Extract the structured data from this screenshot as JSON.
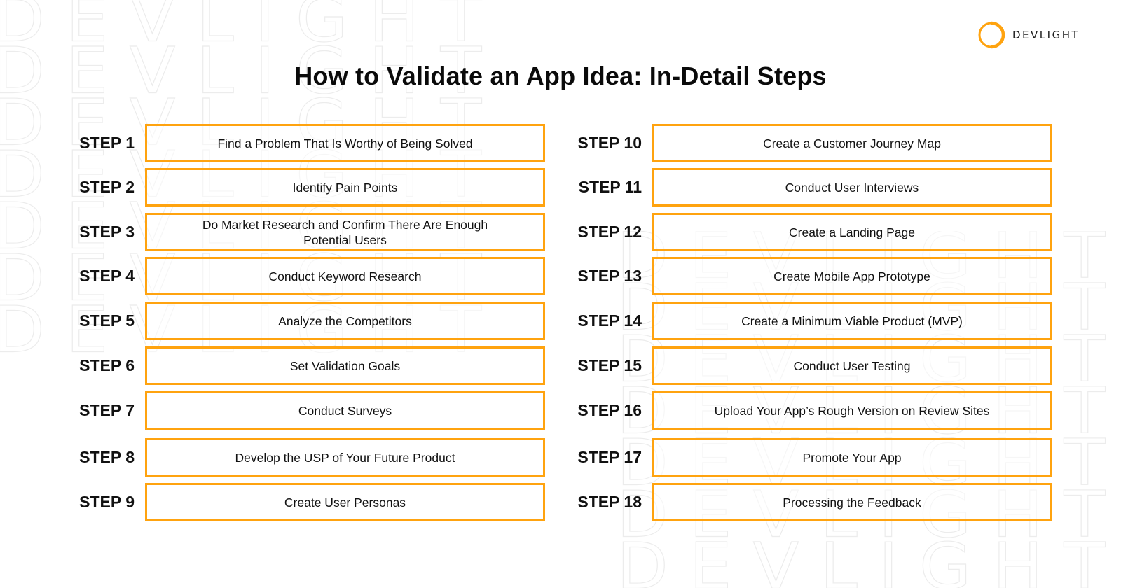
{
  "brand": {
    "name": "DEVLIGHT",
    "accent_color": "#ffa30f",
    "watermark_text": "DEVLIGHT"
  },
  "header": {
    "title": "How to Validate an App Idea: In-Detail Steps"
  },
  "steps_left": [
    {
      "label": "STEP 1",
      "text": "Find a Problem That Is Worthy of Being Solved"
    },
    {
      "label": "STEP 2",
      "text": "Identify Pain Points"
    },
    {
      "label": "STEP 3",
      "text": "Do Market Research and Confirm There Are Enough Potential Users"
    },
    {
      "label": "STEP 4",
      "text": "Conduct Keyword Research"
    },
    {
      "label": "STEP 5",
      "text": "Analyze the Competitors"
    },
    {
      "label": "STEP 6",
      "text": "Set Validation Goals"
    },
    {
      "label": "STEP 7",
      "text": "Conduct Surveys"
    },
    {
      "label": "STEP 8",
      "text": "Develop the USP of Your Future Product"
    },
    {
      "label": "STEP 9",
      "text": "Create User Personas"
    }
  ],
  "steps_right": [
    {
      "label": "STEP 10",
      "text": "Create a Customer Journey Map"
    },
    {
      "label": "STEP 11",
      "text": "Conduct User Interviews"
    },
    {
      "label": "STEP 12",
      "text": "Create a Landing Page"
    },
    {
      "label": "STEP 13",
      "text": "Create Mobile App Prototype"
    },
    {
      "label": "STEP 14",
      "text": "Create a Minimum Viable Product (MVP)"
    },
    {
      "label": "STEP 15",
      "text": "Conduct User Testing"
    },
    {
      "label": "STEP 16",
      "text": "Upload Your App’s Rough Version on Review Sites"
    },
    {
      "label": "STEP 17",
      "text": "Promote Your App"
    },
    {
      "label": "STEP 18",
      "text": "Processing the Feedback"
    }
  ]
}
